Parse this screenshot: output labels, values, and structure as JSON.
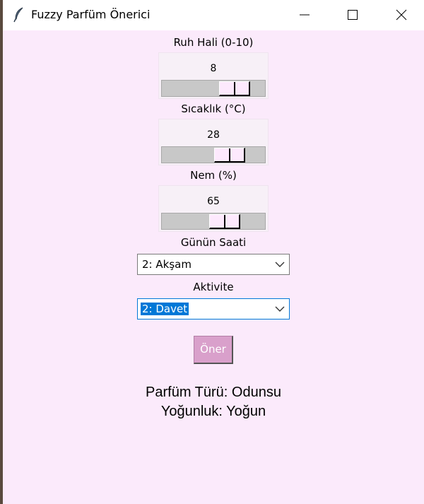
{
  "window": {
    "title": "Fuzzy Parfüm Önerici",
    "icon": "feather-icon",
    "background": "#fbeafb"
  },
  "mood": {
    "label": "Ruh Hali (0-10)",
    "value": "8",
    "min": 0,
    "max": 10
  },
  "temperature": {
    "label": "Sıcaklık (°C)",
    "value": "28"
  },
  "humidity": {
    "label": "Nem (%)",
    "value": "65",
    "min": 0,
    "max": 100
  },
  "time_of_day": {
    "label": "Günün Saati",
    "selected": "2: Akşam"
  },
  "activity": {
    "label": "Aktivite",
    "selected": "2: Davet"
  },
  "recommend_button": {
    "label": "Öner",
    "color": "#d9a0cb"
  },
  "result": {
    "perfume_type": "Parfüm Türü: Odunsu",
    "intensity": "Yoğunluk: Yoğun"
  }
}
